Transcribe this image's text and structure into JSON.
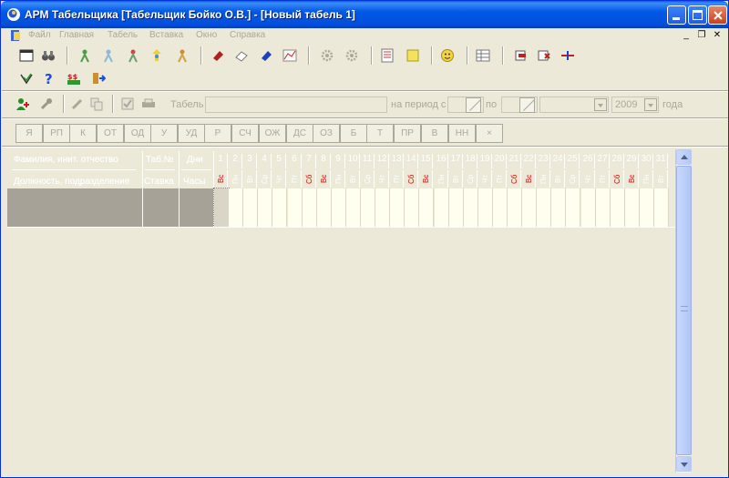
{
  "window": {
    "title": "АРМ Табельщика [Табельщик Бойко О.В.] - [Новый табель 1]"
  },
  "menu": {
    "items": [
      "Файл",
      "Главная",
      "Табель",
      "Вставка",
      "Окно",
      "Справка"
    ]
  },
  "filter": {
    "tabel_label": "Табель",
    "period_label": "на период с",
    "to_label": "по",
    "year_value": "2009",
    "year_suffix": "года"
  },
  "codes": [
    "Я",
    "РП",
    "К",
    "ОТ",
    "ОД",
    "У",
    "УД",
    "Р",
    "СЧ",
    "ОЖ",
    "ДС",
    "ОЗ",
    "Б",
    "Т",
    "ПР",
    "В",
    "НН",
    "×"
  ],
  "grid": {
    "col_name": "Фамилия, инит. отчество",
    "col_position": "Должность, подразделение",
    "col_tab": "Таб.№",
    "col_rate": "Ставка",
    "col_days": "Дни",
    "col_hours": "Часы",
    "days": [
      "1",
      "2",
      "3",
      "4",
      "5",
      "6",
      "7",
      "8",
      "9",
      "10",
      "11",
      "12",
      "13",
      "14",
      "15",
      "16",
      "17",
      "18",
      "19",
      "20",
      "21",
      "22",
      "23",
      "24",
      "25",
      "26",
      "27",
      "28",
      "29",
      "30",
      "31"
    ],
    "weekdays": [
      "Вс",
      "Пн",
      "Вт",
      "Ср",
      "Чт",
      "Пт",
      "Сб",
      "Вс",
      "Пн",
      "Вт",
      "Ср",
      "Чт",
      "Пт",
      "Сб",
      "Вс",
      "Пн",
      "Вт",
      "Ср",
      "Чт",
      "Пт",
      "Сб",
      "Вс",
      "Пн",
      "Вт",
      "Ср",
      "Чт",
      "Пт",
      "Сб",
      "Вс",
      "Пн",
      "Вт"
    ]
  },
  "colors": {
    "titlebar": "#0058E6",
    "weekend": "#E00000",
    "row_fill": "#FFFFEF",
    "disabled_text": "#ACA899"
  }
}
